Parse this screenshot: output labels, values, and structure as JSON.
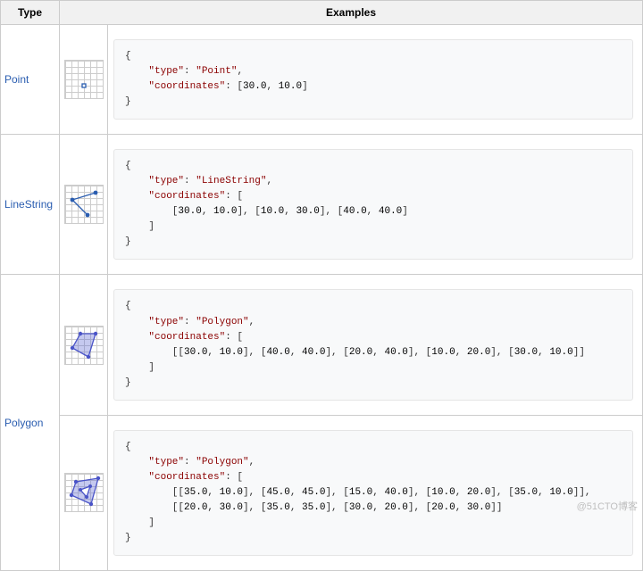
{
  "headers": {
    "type": "Type",
    "examples": "Examples"
  },
  "rows": [
    {
      "label": "Point",
      "examples": [
        {
          "lines": [
            {
              "indent": 0,
              "raw": "{"
            },
            {
              "indent": 1,
              "parts": [
                {
                  "k": "\"type\""
                },
                {
                  "p": ": "
                },
                {
                  "k": "\"Point\""
                },
                {
                  "p": ","
                }
              ]
            },
            {
              "indent": 1,
              "parts": [
                {
                  "k": "\"coordinates\""
                },
                {
                  "p": ": ["
                },
                {
                  "n": "30.0"
                },
                {
                  "p": ", "
                },
                {
                  "n": "10.0"
                },
                {
                  "p": "]"
                }
              ]
            },
            {
              "indent": 0,
              "raw": "}"
            }
          ]
        }
      ]
    },
    {
      "label": "LineString",
      "examples": [
        {
          "lines": [
            {
              "indent": 0,
              "raw": "{"
            },
            {
              "indent": 1,
              "parts": [
                {
                  "k": "\"type\""
                },
                {
                  "p": ": "
                },
                {
                  "k": "\"LineString\""
                },
                {
                  "p": ","
                }
              ]
            },
            {
              "indent": 1,
              "parts": [
                {
                  "k": "\"coordinates\""
                },
                {
                  "p": ": ["
                }
              ]
            },
            {
              "indent": 2,
              "parts": [
                {
                  "p": "["
                },
                {
                  "n": "30.0"
                },
                {
                  "p": ", "
                },
                {
                  "n": "10.0"
                },
                {
                  "p": "], ["
                },
                {
                  "n": "10.0"
                },
                {
                  "p": ", "
                },
                {
                  "n": "30.0"
                },
                {
                  "p": "], ["
                },
                {
                  "n": "40.0"
                },
                {
                  "p": ", "
                },
                {
                  "n": "40.0"
                },
                {
                  "p": "]"
                }
              ]
            },
            {
              "indent": 1,
              "raw": "]"
            },
            {
              "indent": 0,
              "raw": "}"
            }
          ]
        }
      ]
    },
    {
      "label": "Polygon",
      "examples": [
        {
          "lines": [
            {
              "indent": 0,
              "raw": "{"
            },
            {
              "indent": 1,
              "parts": [
                {
                  "k": "\"type\""
                },
                {
                  "p": ": "
                },
                {
                  "k": "\"Polygon\""
                },
                {
                  "p": ","
                }
              ]
            },
            {
              "indent": 1,
              "parts": [
                {
                  "k": "\"coordinates\""
                },
                {
                  "p": ": ["
                }
              ]
            },
            {
              "indent": 2,
              "parts": [
                {
                  "p": "[["
                },
                {
                  "n": "30.0"
                },
                {
                  "p": ", "
                },
                {
                  "n": "10.0"
                },
                {
                  "p": "], ["
                },
                {
                  "n": "40.0"
                },
                {
                  "p": ", "
                },
                {
                  "n": "40.0"
                },
                {
                  "p": "], ["
                },
                {
                  "n": "20.0"
                },
                {
                  "p": ", "
                },
                {
                  "n": "40.0"
                },
                {
                  "p": "], ["
                },
                {
                  "n": "10.0"
                },
                {
                  "p": ", "
                },
                {
                  "n": "20.0"
                },
                {
                  "p": "], ["
                },
                {
                  "n": "30.0"
                },
                {
                  "p": ", "
                },
                {
                  "n": "10.0"
                },
                {
                  "p": "]]"
                }
              ]
            },
            {
              "indent": 1,
              "raw": "]"
            },
            {
              "indent": 0,
              "raw": "}"
            }
          ]
        },
        {
          "lines": [
            {
              "indent": 0,
              "raw": "{"
            },
            {
              "indent": 1,
              "parts": [
                {
                  "k": "\"type\""
                },
                {
                  "p": ": "
                },
                {
                  "k": "\"Polygon\""
                },
                {
                  "p": ","
                }
              ]
            },
            {
              "indent": 1,
              "parts": [
                {
                  "k": "\"coordinates\""
                },
                {
                  "p": ": ["
                }
              ]
            },
            {
              "indent": 2,
              "parts": [
                {
                  "p": "[["
                },
                {
                  "n": "35.0"
                },
                {
                  "p": ", "
                },
                {
                  "n": "10.0"
                },
                {
                  "p": "], ["
                },
                {
                  "n": "45.0"
                },
                {
                  "p": ", "
                },
                {
                  "n": "45.0"
                },
                {
                  "p": "], ["
                },
                {
                  "n": "15.0"
                },
                {
                  "p": ", "
                },
                {
                  "n": "40.0"
                },
                {
                  "p": "], ["
                },
                {
                  "n": "10.0"
                },
                {
                  "p": ", "
                },
                {
                  "n": "20.0"
                },
                {
                  "p": "], ["
                },
                {
                  "n": "35.0"
                },
                {
                  "p": ", "
                },
                {
                  "n": "10.0"
                },
                {
                  "p": "]],"
                }
              ]
            },
            {
              "indent": 2,
              "parts": [
                {
                  "p": "[["
                },
                {
                  "n": "20.0"
                },
                {
                  "p": ", "
                },
                {
                  "n": "30.0"
                },
                {
                  "p": "], ["
                },
                {
                  "n": "35.0"
                },
                {
                  "p": ", "
                },
                {
                  "n": "35.0"
                },
                {
                  "p": "], ["
                },
                {
                  "n": "30.0"
                },
                {
                  "p": ", "
                },
                {
                  "n": "20.0"
                },
                {
                  "p": "], ["
                },
                {
                  "n": "20.0"
                },
                {
                  "p": ", "
                },
                {
                  "n": "30.0"
                },
                {
                  "p": "]]"
                }
              ]
            },
            {
              "indent": 1,
              "raw": "]"
            },
            {
              "indent": 0,
              "raw": "}"
            }
          ]
        }
      ]
    }
  ],
  "watermark": "@51CTO博客"
}
